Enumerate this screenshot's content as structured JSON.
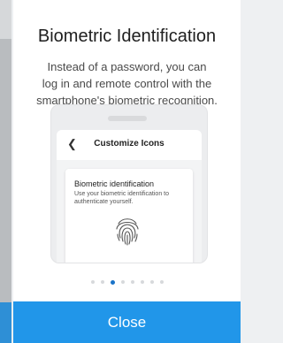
{
  "dialog": {
    "title": "Biometric Identification",
    "description_lines": [
      "Instead of a password, you can",
      "log in and remote control with the",
      "smartphone's biometric recognition."
    ],
    "close_label": "Close"
  },
  "preview": {
    "header_title": "Customize Icons",
    "back_icon": "chevron-left-icon",
    "card_title": "Biometric identification",
    "card_description": "Use your biometric identification to authenticate yourself.",
    "card_icon": "fingerprint-icon"
  },
  "pagination": {
    "total": 8,
    "active_index": 2
  },
  "colors": {
    "accent": "#2196e9",
    "active_dot": "#1a73c8"
  }
}
